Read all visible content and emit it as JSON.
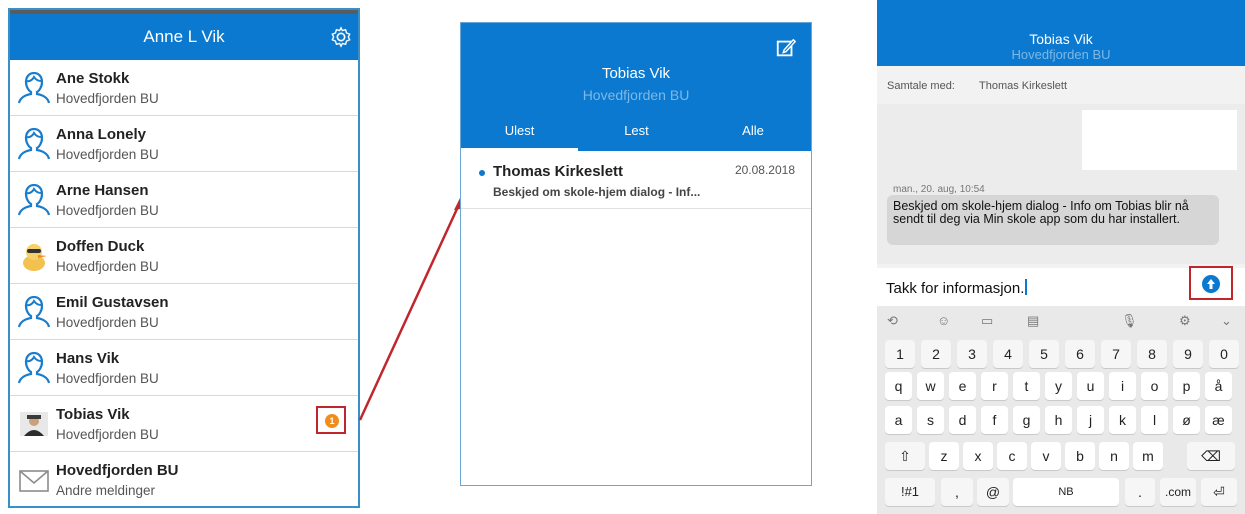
{
  "panel1": {
    "title": "Anne L Vik",
    "contacts": [
      {
        "name": "Ane Stokk",
        "org": "Hovedfjorden BU",
        "avatar": "person-outline-icon"
      },
      {
        "name": "Anna Lonely",
        "org": "Hovedfjorden BU",
        "avatar": "person-outline-icon"
      },
      {
        "name": "Arne Hansen",
        "org": "Hovedfjorden BU",
        "avatar": "person-outline-icon"
      },
      {
        "name": "Doffen Duck",
        "org": "Hovedfjorden BU",
        "avatar": "duck-avatar-icon"
      },
      {
        "name": "Emil Gustavsen",
        "org": "Hovedfjorden BU",
        "avatar": "person-outline-icon"
      },
      {
        "name": "Hans Vik",
        "org": "Hovedfjorden BU",
        "avatar": "person-outline-icon"
      },
      {
        "name": "Tobias Vik",
        "org": "Hovedfjorden BU",
        "avatar": "photo-avatar-icon",
        "badge": "1"
      },
      {
        "name": "Hovedfjorden BU",
        "org": "Andre meldinger",
        "avatar": "envelope-icon"
      }
    ]
  },
  "panel2": {
    "name": "Tobias Vik",
    "org": "Hovedfjorden BU",
    "tabs": [
      "Ulest",
      "Lest",
      "Alle"
    ],
    "message": {
      "from": "Thomas Kirkeslett",
      "date": "20.08.2018",
      "preview": "Beskjed om skole-hjem dialog - Inf..."
    }
  },
  "panel3": {
    "name": "Tobias Vik",
    "org": "Hovedfjorden BU",
    "conversation_label": "Samtale med:",
    "conversation_with": "Thomas Kirkeslett",
    "timestamp": "man., 20. aug, 10:54",
    "bubble": "Beskjed om skole-hjem dialog - Info om Tobias blir nå sendt til deg via Min skole app som du har installert.",
    "input_value": "Takk for informasjon.",
    "keyboard": {
      "numbers": [
        "1",
        "2",
        "3",
        "4",
        "5",
        "6",
        "7",
        "8",
        "9",
        "0"
      ],
      "row1": [
        "q",
        "w",
        "e",
        "r",
        "t",
        "y",
        "u",
        "i",
        "o",
        "p",
        "å"
      ],
      "row2": [
        "a",
        "s",
        "d",
        "f",
        "g",
        "h",
        "j",
        "k",
        "l",
        "ø",
        "æ"
      ],
      "row3": [
        "z",
        "x",
        "c",
        "v",
        "b",
        "n",
        "m"
      ],
      "bottom": {
        "sym": "!#1",
        "comma": ",",
        "at": "@",
        "space": "NB",
        "period": ".",
        "com": ".com"
      }
    }
  },
  "colors": {
    "brand": "#0a79cf",
    "badge": "#f28d1b",
    "highlight": "#c0272d"
  }
}
